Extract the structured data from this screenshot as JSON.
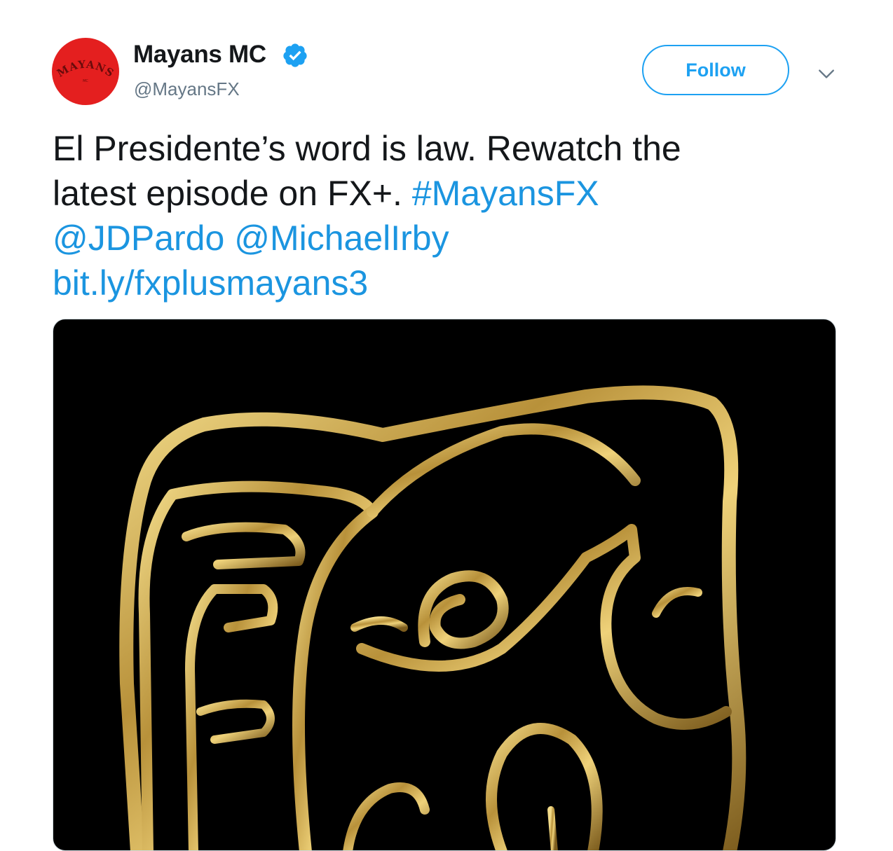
{
  "account": {
    "display_name": "Mayans MC",
    "handle": "@MayansFX",
    "verified": true,
    "avatar_text": "MAYANS",
    "avatar_subtext": "MC",
    "avatar_color": "#e41f1f"
  },
  "follow_button": {
    "label": "Follow"
  },
  "tweet": {
    "line1": "El Presidente’s word is law. Rewatch the",
    "line2_text": "latest episode on FX+.",
    "hashtag": "#MayansFX",
    "mention1": "@JDPardo",
    "mention2": "@MichaelIrby",
    "url": "bit.ly/fxplusmayans3"
  },
  "media": {
    "kind": "video-thumbnail",
    "background": "#000000",
    "accent": "#c9a84a"
  },
  "colors": {
    "link": "#1b95e0",
    "follow": "#1da1f2",
    "secondary": "#657786"
  },
  "icons": {
    "verified": "verified-badge-icon",
    "menu": "chevron-down-icon"
  }
}
